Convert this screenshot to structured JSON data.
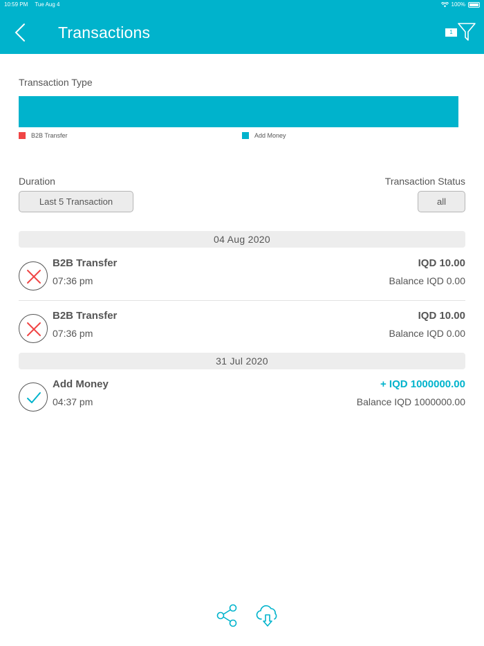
{
  "status_bar": {
    "time": "10:59 PM",
    "date": "Tue Aug 4",
    "battery": "100%"
  },
  "header": {
    "title": "Transactions",
    "filter_count": "1"
  },
  "transaction_type": {
    "label": "Transaction Type",
    "legend": [
      {
        "name": "B2B Transfer",
        "color": "#f04545"
      },
      {
        "name": "Add Money",
        "color": "#00b3cc"
      }
    ]
  },
  "filters": {
    "duration_label": "Duration",
    "duration_value": "Last 5 Transaction",
    "status_label": "Transaction Status",
    "status_value": "all"
  },
  "groups": [
    {
      "date": "04 Aug 2020",
      "items": [
        {
          "name": "B2B Transfer",
          "time": "07:36 pm",
          "amount": "IQD 10.00",
          "balance": "Balance IQD 0.00",
          "status": "failed"
        },
        {
          "name": "B2B Transfer",
          "time": "07:36 pm",
          "amount": "IQD 10.00",
          "balance": "Balance IQD 0.00",
          "status": "failed"
        }
      ]
    },
    {
      "date": "31 Jul 2020",
      "items": [
        {
          "name": "Add Money",
          "time": "04:37 pm",
          "amount": "+ IQD 1000000.00",
          "balance": "Balance IQD 1000000.00",
          "status": "success"
        }
      ]
    }
  ],
  "icons": {
    "back": "chevron-left-icon",
    "filter": "funnel-icon",
    "share": "share-icon",
    "download": "cloud-download-icon",
    "failed": "x-icon",
    "success": "check-icon"
  },
  "colors": {
    "accent": "#00b3cc",
    "failed": "#f04545",
    "text": "#555555"
  }
}
